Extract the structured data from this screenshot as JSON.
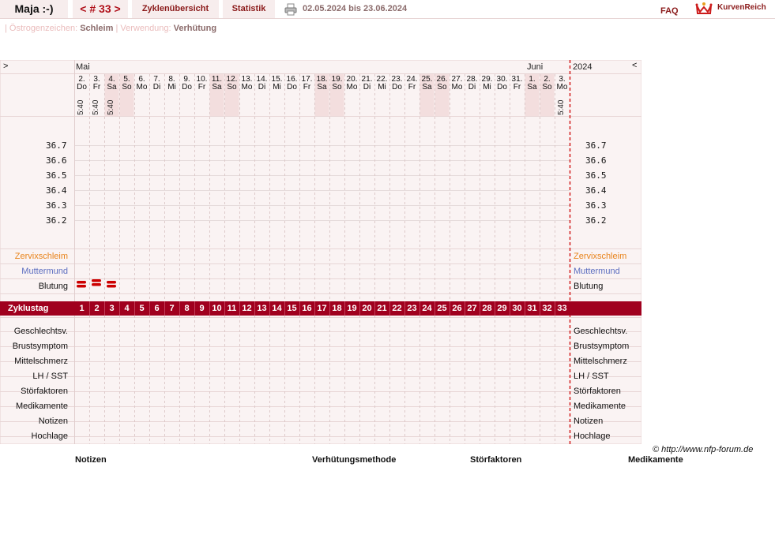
{
  "header": {
    "user": "Maja :-)",
    "cycle": "< # 33 >",
    "overview": "Zyklenübersicht",
    "stats": "Statistik",
    "date_range": "02.05.2024 bis 23.06.2024",
    "faq": "FAQ",
    "logo": "KurvenReich",
    "print_icon": "printer-icon",
    "logo_icon": "crown-icon"
  },
  "subline": {
    "sep": "|",
    "estrogen_label": "Östrogenzeichen:",
    "estrogen_value": "Schleim",
    "usage_label": "Verwendung:",
    "usage_value": "Verhütung"
  },
  "chart": {
    "nav_prev": ">",
    "nav_next": "<",
    "month1": "Mai",
    "month2": "Juni",
    "year": "2024",
    "days": [
      {
        "d": "2.",
        "w": "Do"
      },
      {
        "d": "3.",
        "w": "Fr"
      },
      {
        "d": "4.",
        "w": "Sa"
      },
      {
        "d": "5.",
        "w": "So"
      },
      {
        "d": "6.",
        "w": "Mo"
      },
      {
        "d": "7.",
        "w": "Di"
      },
      {
        "d": "8.",
        "w": "Mi"
      },
      {
        "d": "9.",
        "w": "Do"
      },
      {
        "d": "10.",
        "w": "Fr"
      },
      {
        "d": "11.",
        "w": "Sa"
      },
      {
        "d": "12.",
        "w": "So"
      },
      {
        "d": "13.",
        "w": "Mo"
      },
      {
        "d": "14.",
        "w": "Di"
      },
      {
        "d": "15.",
        "w": "Mi"
      },
      {
        "d": "16.",
        "w": "Do"
      },
      {
        "d": "17.",
        "w": "Fr"
      },
      {
        "d": "18.",
        "w": "Sa"
      },
      {
        "d": "19.",
        "w": "So"
      },
      {
        "d": "20.",
        "w": "Mo"
      },
      {
        "d": "21.",
        "w": "Di"
      },
      {
        "d": "22.",
        "w": "Mi"
      },
      {
        "d": "23.",
        "w": "Do"
      },
      {
        "d": "24.",
        "w": "Fr"
      },
      {
        "d": "25.",
        "w": "Sa"
      },
      {
        "d": "26.",
        "w": "So"
      },
      {
        "d": "27.",
        "w": "Mo"
      },
      {
        "d": "28.",
        "w": "Di"
      },
      {
        "d": "29.",
        "w": "Mi"
      },
      {
        "d": "30.",
        "w": "Do"
      },
      {
        "d": "31.",
        "w": "Fr"
      },
      {
        "d": "1.",
        "w": "Sa"
      },
      {
        "d": "2.",
        "w": "So"
      },
      {
        "d": "3.",
        "w": "Mo"
      }
    ],
    "weekend_indices": [
      2,
      3,
      9,
      10,
      16,
      17,
      23,
      24,
      30,
      31
    ],
    "times": [
      "5:40",
      "5:40",
      "5:40",
      "",
      "",
      "",
      "",
      "",
      "",
      "",
      "",
      "",
      "",
      "",
      "",
      "",
      "",
      "",
      "",
      "",
      "",
      "",
      "",
      "",
      "",
      "",
      "",
      "",
      "",
      "",
      "",
      "",
      "5:40"
    ],
    "temp_labels": [
      "36.7",
      "36.6",
      "36.5",
      "36.4",
      "36.3",
      "36.2"
    ],
    "rows_top": [
      "Zervixschleim",
      "Muttermund",
      "Blutung"
    ],
    "bleeding_days": [
      0,
      1,
      2
    ],
    "cycle_label": "Zyklustag",
    "cycle_days": [
      "1",
      "2",
      "3",
      "4",
      "5",
      "6",
      "7",
      "8",
      "9",
      "10",
      "11",
      "12",
      "13",
      "14",
      "15",
      "16",
      "17",
      "18",
      "19",
      "20",
      "21",
      "22",
      "23",
      "24",
      "25",
      "26",
      "27",
      "28",
      "29",
      "30",
      "31",
      "32",
      "33"
    ],
    "rows_bottom": [
      "Geschlechtsv.",
      "Brustsymptom",
      "Mittelschmerz",
      "LH / SST",
      "Störfaktoren",
      "Medikamente",
      "Notizen",
      "Hochlage"
    ],
    "colors": {
      "accent": "#a0001e",
      "weekend": "#f3dede",
      "bg": "#faf3f3",
      "marker": "#cc0000"
    }
  },
  "copyright": "© http://www.nfp-forum.de",
  "footer": {
    "notes": "Notizen",
    "method": "Verhütungsmethode",
    "disturb": "Störfaktoren",
    "meds": "Medikamente"
  }
}
